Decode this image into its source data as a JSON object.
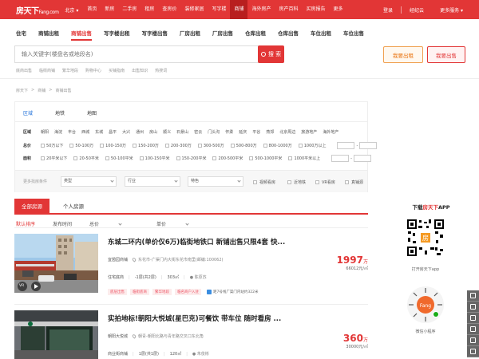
{
  "topnav": {
    "logo": "房天下",
    "logo_suffix": "Fang.com",
    "city": "北京",
    "items": [
      "首页",
      "新房",
      "二手房",
      "租房",
      "查房价",
      "装修家居",
      "写字楼",
      "商铺",
      "海外房产",
      "房产百科",
      "买房报告",
      "更多"
    ],
    "active_index": 7,
    "right": [
      "登录",
      "经纪云",
      "更多服务"
    ]
  },
  "category_tabs": {
    "items": [
      "住宅",
      "商铺出租",
      "商铺出售",
      "写字楼出租",
      "写字楼出售",
      "厂房出租",
      "厂房出售",
      "仓库出租",
      "仓库出售",
      "车位出租",
      "车位出售"
    ],
    "active_index": 2
  },
  "search": {
    "placeholder": "输入关键字(楼盘名或地段名)",
    "button": "搜 索"
  },
  "actions": {
    "rent_label": "我要出租",
    "sale_label": "我要出售"
  },
  "hot_keywords": [
    "底商出售",
    "临街商铺",
    "繁华地段",
    "购物中心",
    "买铺指南",
    "出售知识",
    "热搜词"
  ],
  "breadcrumb": [
    "房天下",
    ">",
    "商铺",
    ">",
    "商铺出售"
  ],
  "filter": {
    "tabs": [
      "区域",
      "地铁",
      "地图"
    ],
    "active_tab": 0,
    "district_label": "区域",
    "districts": [
      "朝阳",
      "海淀",
      "丰台",
      "西城",
      "东城",
      "昌平",
      "大兴",
      "通州",
      "房山",
      "顺义",
      "石景山",
      "密云",
      "门头沟",
      "怀柔",
      "延庆",
      "平谷",
      "燕郊",
      "北京周边",
      "旅游地产",
      "海外地产"
    ],
    "price_label": "总价",
    "prices": [
      "50万以下",
      "50-100万",
      "100-150万",
      "150-200万",
      "200-300万",
      "300-500万",
      "500-800万",
      "800-1000万",
      "1000万以上"
    ],
    "area_label": "面积",
    "areas": [
      "20平米以下",
      "20-50平米",
      "50-100平米",
      "100-150平米",
      "150-200平米",
      "200-500平米",
      "500-1000平米",
      "1000平米以上"
    ],
    "more_label": "更多找房条件",
    "selects": [
      "类型",
      "行业",
      "特色"
    ],
    "checks": [
      "视频看房",
      "近地铁",
      "VR看房",
      "真铺源"
    ]
  },
  "list_tabs": {
    "all": "全部房源",
    "personal": "个人房源"
  },
  "sort": [
    "默认排序",
    "发布时间",
    "总价",
    "单价"
  ],
  "listings": [
    {
      "title": "东城二环内(单价仅6万)临街地铁口 新铺出售只限4套 快...",
      "building": "宜茵园商铺",
      "address": "东花市-广渠门内大街东花市南里(邮编:100062)",
      "type": "住宅底商",
      "floor": "-1层(共2层)",
      "area": "303㎡",
      "agent": "陈原苏",
      "tags": [
        "底层出售",
        "临街底商",
        "繁华地段",
        "临名商户入驻"
      ],
      "subway": "距7号线广渠门内站约322米",
      "price": "1997",
      "price_unit": "万",
      "unit_price": "66012元/㎡"
    },
    {
      "title": "实拍地标!朝阳大悦城(星巴克)可餐饮 带车位 随时看房 ...",
      "building": "朝阳大悦城",
      "address": "朝青-朝阳北路与青年路交叉口东北角",
      "type": "商业街商铺",
      "floor": "1层(共1层)",
      "area": "120㎡",
      "agent": "朱俊彬",
      "price": "360",
      "price_unit": "万",
      "unit_price": "30000元/㎡"
    }
  ],
  "sidebar": {
    "download_title_pre": "下载",
    "download_title_brand": "房天下",
    "download_title_post": "APP",
    "app_caption": "打开房天下app",
    "mini_caption": "微信小程序"
  },
  "colors": {
    "brand_red": "#e23636",
    "link_blue": "#1e6fd9",
    "orange": "#e8700a"
  }
}
